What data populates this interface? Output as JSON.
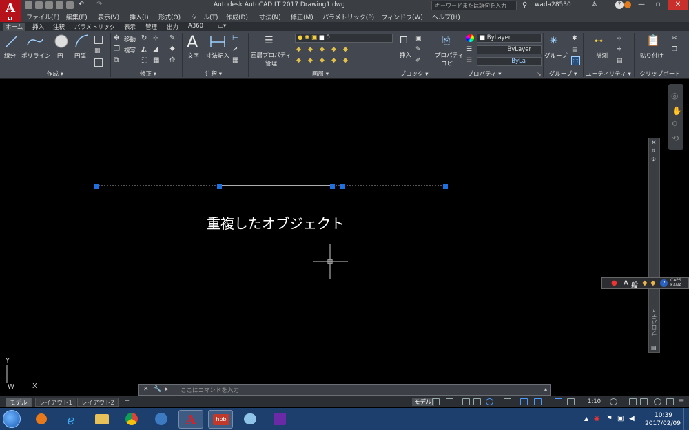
{
  "title_bar": {
    "window_title": "Autodesk AutoCAD LT 2017    Drawing1.dwg",
    "search_placeholder": "キーワードまたは語句を入力",
    "username": "wada28530",
    "app_logo": "A",
    "app_logo_sub": "LT"
  },
  "menu": {
    "items": [
      "ファイル(F)",
      "編集(E)",
      "表示(V)",
      "挿入(I)",
      "形式(O)",
      "ツール(T)",
      "作成(D)",
      "寸法(N)",
      "修正(M)",
      "パラメトリック(P)",
      "ウィンドウ(W)",
      "ヘルプ(H)"
    ]
  },
  "ribbon_tabs": [
    "ホーム",
    "挿入",
    "注釈",
    "パラメトリック",
    "表示",
    "管理",
    "出力",
    "A360"
  ],
  "ribbon": {
    "draw": {
      "title": "作成 ▾",
      "line": "線分",
      "polyline": "ポリライン",
      "circle": "円",
      "arc": "円弧"
    },
    "modify": {
      "title": "修正 ▾",
      "move": "移動",
      "copy": "複写"
    },
    "annotation": {
      "title": "注釈 ▾",
      "text": "文字",
      "dimension": "寸法記入"
    },
    "layers": {
      "title": "画層 ▾",
      "properties_line1": "画層プロパティ",
      "properties_line2": "管理",
      "current_layer": "0"
    },
    "block": {
      "title": "ブロック ▾",
      "insert": "挿入"
    },
    "properties": {
      "title": "プロパティ ▾",
      "copy_line1": "プロパティ",
      "copy_line2": "コピー",
      "color": "ByLayer",
      "linetype": "ByLayer",
      "lineweight": "ByLa"
    },
    "groups": {
      "title": "グループ ▾",
      "group": "グループ"
    },
    "utilities": {
      "title": "ユーティリティ ▾",
      "measure": "計測"
    },
    "clipboard": {
      "title": "クリップボード",
      "paste": "貼り付け"
    }
  },
  "drawing": {
    "annotation": "重複したオブジェクト",
    "ucs_y": "Y",
    "ucs_x": "X",
    "ucs_w": "W"
  },
  "properties_palette": {
    "title": "プロパティ"
  },
  "ime_bar": {
    "mode": "A",
    "dictionary": "般",
    "caps": "CAPS",
    "kana": "KANA"
  },
  "command_line": {
    "placeholder": "ここにコマンドを入力"
  },
  "layout_tabs": [
    "モデル",
    "レイアウト1",
    "レイアウト2",
    "+"
  ],
  "status_bar": {
    "model": "モデル",
    "scale": "1:10"
  },
  "taskbar": {
    "time": "10:39",
    "date": "2017/02/09",
    "hpb_label": "hpb"
  },
  "colors": {
    "selection_grip": "#1e6fe0",
    "accent_red": "#b5121b",
    "taskbar": "#1c3f6e"
  }
}
